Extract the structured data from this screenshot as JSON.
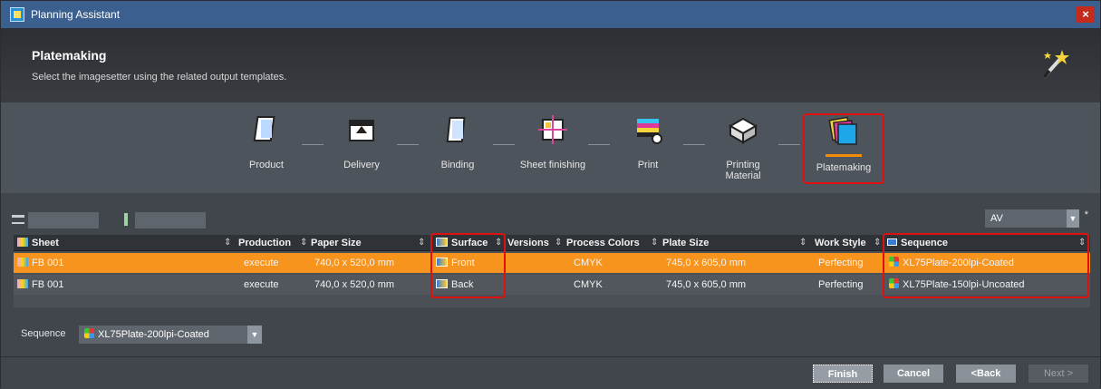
{
  "window": {
    "title": "Planning Assistant",
    "close_label": "×"
  },
  "header": {
    "title": "Platemaking",
    "subtitle": "Select the imagesetter using the related output templates."
  },
  "steps": [
    {
      "label": "Product",
      "icon": "product-icon"
    },
    {
      "label": "Delivery",
      "icon": "delivery-icon"
    },
    {
      "label": "Binding",
      "icon": "binding-icon"
    },
    {
      "label": "Sheet finishing",
      "icon": "sheet-finishing-icon"
    },
    {
      "label": "Print",
      "icon": "print-icon"
    },
    {
      "label": "Printing Material",
      "icon": "printing-material-icon"
    },
    {
      "label": "Platemaking",
      "icon": "platemaking-icon",
      "active": true
    }
  ],
  "toolbar": {
    "av_value": "AV",
    "required_mark": "*"
  },
  "table": {
    "columns": [
      "Sheet",
      "Production",
      "Paper Size",
      "Surface",
      "Versions",
      "Process Colors",
      "Plate Size",
      "Work Style",
      "Sequence"
    ],
    "rows": [
      {
        "sheet": "FB 001",
        "production": "execute",
        "paper_size": "740,0 x 520,0 mm",
        "surface": "Front",
        "versions": "",
        "process_colors": "CMYK",
        "plate_size": "745,0 x 605,0 mm",
        "work_style": "Perfecting",
        "sequence": "XL75Plate-200lpi-Coated"
      },
      {
        "sheet": "FB 001",
        "production": "execute",
        "paper_size": "740,0 x 520,0 mm",
        "surface": "Back",
        "versions": "",
        "process_colors": "CMYK",
        "plate_size": "745,0 x 605,0 mm",
        "work_style": "Perfecting",
        "sequence": "XL75Plate-150lpi-Uncoated"
      }
    ]
  },
  "sequence_picker": {
    "label": "Sequence",
    "value": "XL75Plate-200lpi-Coated"
  },
  "buttons": {
    "finish": "Finish",
    "cancel": "Cancel",
    "back": "<Back",
    "next": "Next >"
  },
  "colors": {
    "accent": "#f7941d",
    "highlight": "#e01010",
    "titlebar": "#3b5f8e"
  }
}
